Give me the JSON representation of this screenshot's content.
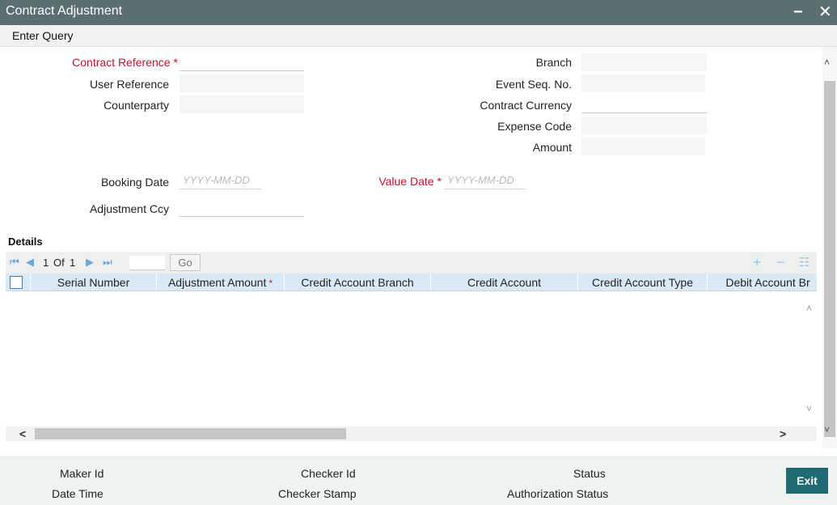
{
  "window": {
    "title": "Contract Adjustment",
    "minimize_glyph": "−",
    "close_glyph": "✕"
  },
  "menu": {
    "enter_query": "Enter Query"
  },
  "form": {
    "contract_reference": {
      "label": "Contract Reference",
      "required": "*",
      "value": ""
    },
    "user_reference": {
      "label": "User Reference",
      "value": ""
    },
    "counterparty": {
      "label": "Counterparty",
      "value": ""
    },
    "branch": {
      "label": "Branch",
      "value": ""
    },
    "event_seq_no": {
      "label": "Event Seq. No.",
      "value": ""
    },
    "contract_currency": {
      "label": "Contract Currency",
      "value": ""
    },
    "expense_code": {
      "label": "Expense Code",
      "value": ""
    },
    "amount": {
      "label": "Amount",
      "value": ""
    },
    "booking_date": {
      "label": "Booking Date",
      "placeholder": "YYYY-MM-DD"
    },
    "value_date": {
      "label": "Value Date",
      "required": "*",
      "placeholder": "YYYY-MM-DD"
    },
    "adjustment_ccy": {
      "label": "Adjustment Ccy",
      "value": ""
    }
  },
  "details": {
    "title": "Details",
    "pager": {
      "current": "1",
      "of_label": "Of",
      "total": "1",
      "go_label": "Go"
    },
    "icons": [
      "first-page-icon",
      "prev-page-icon",
      "next-page-icon",
      "last-page-icon",
      "add-row-icon",
      "delete-row-icon",
      "list-view-icon"
    ],
    "columns": [
      {
        "label": "Serial Number",
        "required": ""
      },
      {
        "label": "Adjustment Amount",
        "required": "*"
      },
      {
        "label": "Credit Account Branch",
        "required": ""
      },
      {
        "label": "Credit Account",
        "required": ""
      },
      {
        "label": "Credit Account Type",
        "required": ""
      },
      {
        "label": "Debit Account Br",
        "required": ""
      }
    ],
    "rows": []
  },
  "footer": {
    "maker_id": "Maker Id",
    "date_time": "Date Time",
    "checker_id": "Checker Id",
    "checker_stamp": "Checker Stamp",
    "status": "Status",
    "authorization_status": "Authorization Status",
    "exit_label": "Exit"
  },
  "colors": {
    "titlebar": "#5b6f73",
    "required": "#c8102e",
    "grid_header": "#d9e9f5",
    "exit_button": "#1f6a73"
  }
}
